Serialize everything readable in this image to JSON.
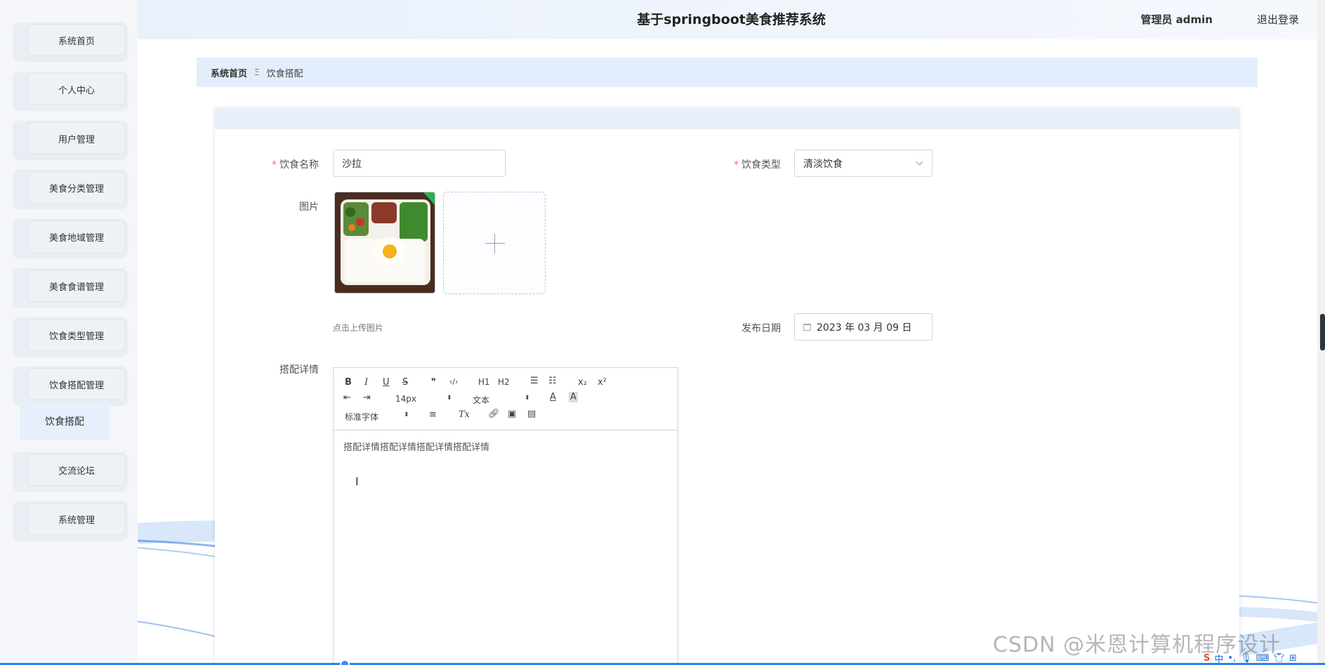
{
  "app": {
    "title": "基于springboot美食推荐系统",
    "user_label": "管理员 admin",
    "logout_label": "退出登录"
  },
  "sidebar": {
    "items": [
      {
        "label": "系统首页"
      },
      {
        "label": "个人中心"
      },
      {
        "label": "用户管理"
      },
      {
        "label": "美食分类管理"
      },
      {
        "label": "美食地域管理"
      },
      {
        "label": "美食食谱管理"
      },
      {
        "label": "饮食类型管理"
      },
      {
        "label": "饮食搭配管理"
      },
      {
        "label": "交流论坛"
      },
      {
        "label": "系统管理"
      }
    ],
    "submenu": {
      "label": "饮食搭配"
    }
  },
  "breadcrumb": {
    "home": "系统首页",
    "separator": "Ξ",
    "current": "饮食搭配"
  },
  "form": {
    "name_label": "饮食名称",
    "name_value": "沙拉",
    "type_label": "饮食类型",
    "type_value": "清淡饮食",
    "image_label": "图片",
    "upload_hint": "点击上传图片",
    "date_label": "发布日期",
    "date_value": "2023 年 03 月 09 日",
    "detail_label": "搭配详情",
    "required_mark": "*"
  },
  "editor": {
    "toolbar": {
      "bold": "B",
      "italic": "I",
      "underline": "U",
      "strike": "S",
      "quote": "❞",
      "code": "‹/›",
      "h1": "H1",
      "h2": "H2",
      "subscript": "x₂",
      "superscript": "x²",
      "font_size": "14px",
      "block_type": "文本",
      "font_family": "标准字体",
      "clean": "Tx"
    },
    "content": "搭配详情搭配详情搭配详情搭配详情"
  },
  "watermark": "CSDN @米恩计算机程序设计",
  "colors": {
    "accent": "#2d7ff0",
    "header_bg": "#eaf1fb",
    "breadcrumb_bg": "#e4edfb",
    "required": "#f56c6c"
  }
}
